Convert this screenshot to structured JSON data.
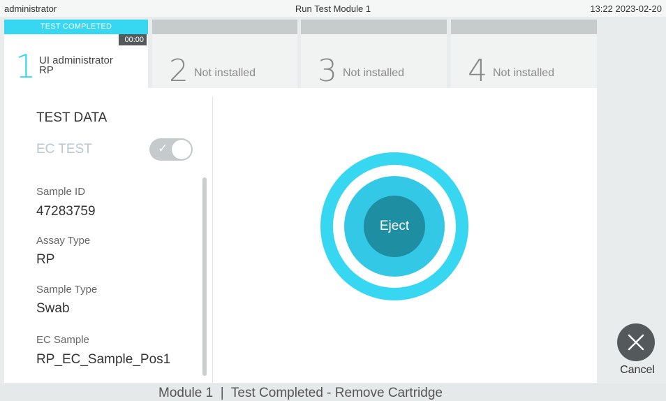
{
  "topbar": {
    "user": "administrator",
    "title": "Run Test Module 1",
    "datetime": "13:22 2023-02-20"
  },
  "modules": [
    {
      "number": "1",
      "status": "TEST COMPLETED",
      "timer": "00:00",
      "user": "UI administrator",
      "assay": "RP"
    },
    {
      "number": "2",
      "label": "Not installed"
    },
    {
      "number": "3",
      "label": "Not installed"
    },
    {
      "number": "4",
      "label": "Not installed"
    }
  ],
  "test_data": {
    "title": "TEST DATA",
    "ec_test_label": "EC TEST",
    "ec_test_enabled": true,
    "fields": [
      {
        "label": "Sample ID",
        "value": "47283759"
      },
      {
        "label": "Assay Type",
        "value": "RP"
      },
      {
        "label": "Sample Type",
        "value": "Swab"
      },
      {
        "label": "EC Sample",
        "value": "RP_EC_Sample_Pos1"
      }
    ]
  },
  "eject": {
    "label": "Eject"
  },
  "cancel": {
    "label": "Cancel",
    "icon": "close-icon"
  },
  "footer": {
    "message": "Module 1  |  Test Completed - Remove Cartridge"
  },
  "colors": {
    "accent": "#37d7f2",
    "eject_inner": "#1e8fa3",
    "ring_mid": "#32c8e6",
    "dark": "#545a5c"
  }
}
